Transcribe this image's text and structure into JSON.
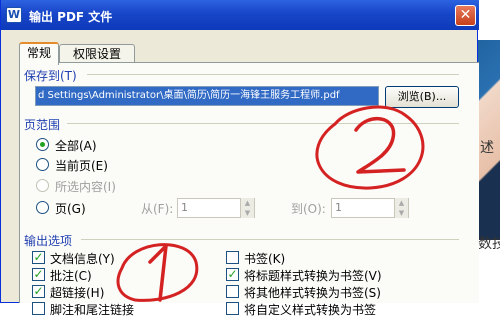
{
  "window": {
    "title": "输出 PDF 文件",
    "app_icon": "W",
    "close_glyph": "✕"
  },
  "tabs": [
    {
      "label": "常规"
    },
    {
      "label": "权限设置"
    }
  ],
  "save_to": {
    "label": "保存到(T)",
    "path": "d Settings\\Administrator\\桌面\\简历\\简历一海锋王服务工程师.pdf",
    "browse_label": "浏览(B)..."
  },
  "page_range": {
    "label": "页范围",
    "options": [
      {
        "label": "全部(A)",
        "selected": true,
        "enabled": true
      },
      {
        "label": "当前页(E)",
        "selected": false,
        "enabled": true
      },
      {
        "label": "所选内容(I)",
        "selected": false,
        "enabled": false
      },
      {
        "label": "页(G)",
        "selected": false,
        "enabled": true
      }
    ],
    "from_label": "从(F):",
    "from_value": "1",
    "to_label": "到(O):",
    "to_value": "1"
  },
  "output_options": {
    "label": "输出选项",
    "left": [
      {
        "label": "文档信息(Y)",
        "checked": true
      },
      {
        "label": "批注(C)",
        "checked": true
      },
      {
        "label": "超链接(H)",
        "checked": true
      },
      {
        "label": "脚注和尾注链接",
        "checked": false
      }
    ],
    "right": [
      {
        "label": "书签(K)",
        "checked": false
      },
      {
        "label": "将标题样式转换为书签(V)",
        "checked": true
      },
      {
        "label": "将其他样式转换为书签(S)",
        "checked": false
      },
      {
        "label": "将自定义样式转换为书签",
        "checked": false
      }
    ]
  },
  "annotations": [
    {
      "text": "2",
      "color": "#d42222"
    },
    {
      "text": "1",
      "color": "#d42222"
    }
  ],
  "background": {
    "right_text_1": "述",
    "right_text_2": "数技"
  },
  "colors": {
    "titlebar": "#1846c8",
    "selection": "#316ac5",
    "check": "#21a121",
    "annotation": "#d42222"
  }
}
